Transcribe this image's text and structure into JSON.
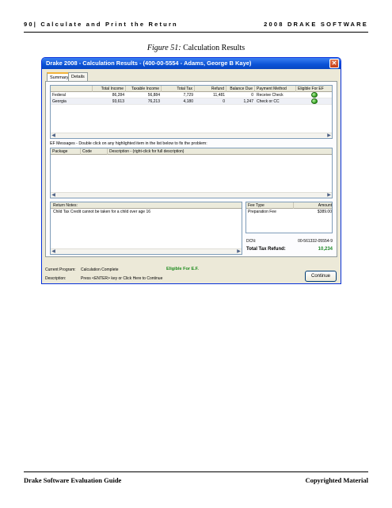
{
  "page": {
    "header_left": "90| Calculate and Print the Return",
    "header_right": "2008 DRAKE SOFTWARE",
    "caption_label": "Figure 51:",
    "caption_text": " Calculation Results",
    "footer_left": "Drake Software Evaluation Guide",
    "footer_right": "Copyrighted Material"
  },
  "window": {
    "title": "Drake 2008 - Calculation Results - (400-00-5554 - Adams, George B Kaye)",
    "close_glyph": "✕",
    "tabs": [
      "Summary",
      "Details"
    ],
    "summary": {
      "columns": [
        "",
        "Total Income",
        "Taxable Income",
        "Total Tax",
        "Refund",
        "Balance Due",
        "Payment Method",
        "Eligible For EF"
      ],
      "rows": [
        {
          "name": "Federal",
          "total_income": "86,284",
          "taxable_income": "56,884",
          "total_tax": "7,729",
          "refund": "11,481",
          "balance_due": "0",
          "payment_method": "Receive Check",
          "eligible_icon": "green-light-icon"
        },
        {
          "name": "Georgia",
          "total_income": "93,613",
          "taxable_income": "76,213",
          "total_tax": "4,180",
          "refund": "0",
          "balance_due": "1,247",
          "payment_method": "Check or CC",
          "eligible_icon": "green-light-icon"
        }
      ]
    },
    "ef_messages": {
      "label": "EF Messages - Double click on any highlighted item in the list below to fix the problem:",
      "columns": [
        "Package",
        "Code",
        "Description - (right-click for full description)"
      ]
    },
    "return_notes": {
      "header": "Return Notes:",
      "lines": [
        "Child Tax Credit cannot be taken for a child over age 16"
      ]
    },
    "fees": {
      "columns": [
        "Fee Type",
        "Amount"
      ],
      "rows": [
        {
          "type": "Preparation Fee",
          "amount": "$389.00"
        }
      ],
      "dcn_label": "DCN:",
      "dcn_value": "00-561332-05554-9",
      "total_label": "Total Tax Refund:",
      "total_value": "10,234"
    },
    "status": {
      "current_program_label": "Current Program:",
      "current_program_value": "Calculation Complete",
      "eligible_text": "Eligible For E.F.",
      "description_label": "Description:",
      "description_value": "Press <ENTER> key or Click Here to Continue"
    },
    "continue_label": "Continue",
    "colors": {
      "titlebar": "#0a52d6",
      "eligible_green": "#1f8c1f"
    }
  }
}
